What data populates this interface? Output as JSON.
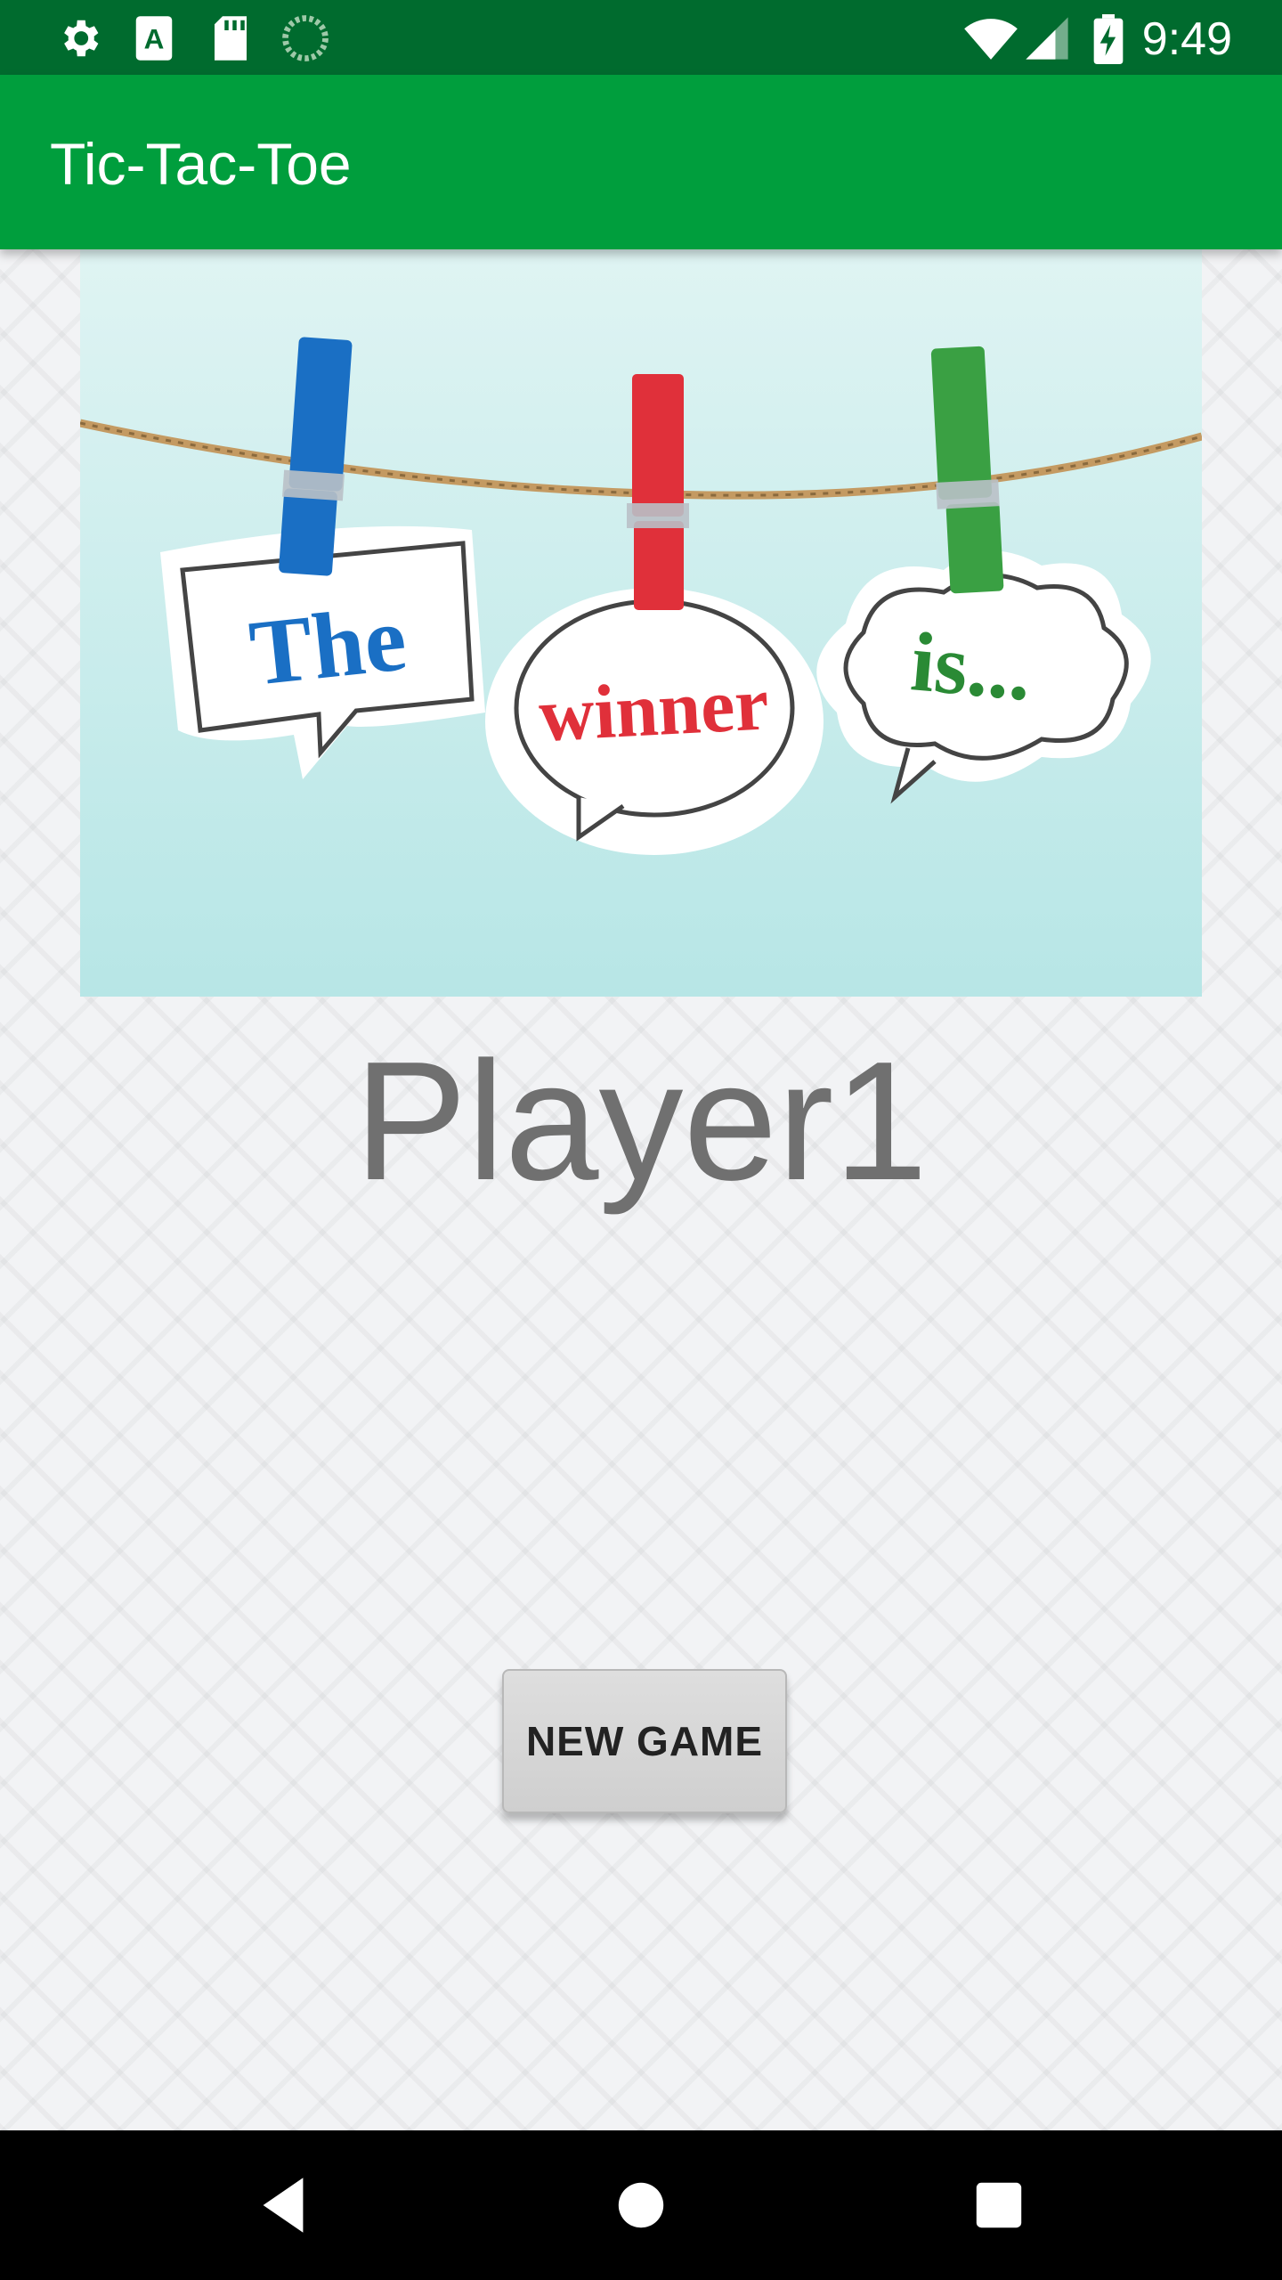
{
  "status_bar": {
    "time": "9:49",
    "icons": [
      "settings-icon",
      "text-a-icon",
      "sd-card-icon",
      "sync-progress-icon",
      "wifi-icon",
      "cell-signal-icon",
      "battery-charging-icon"
    ]
  },
  "app_bar": {
    "title": "Tic-Tac-Toe"
  },
  "hero_image": {
    "words": [
      "The",
      "winner",
      "is..."
    ],
    "background_color": "#bfeaea",
    "peg_colors": [
      "#1a6fc4",
      "#e0303a",
      "#3aa043"
    ]
  },
  "result": {
    "winner": "Player1"
  },
  "actions": {
    "new_game_label": "NEW GAME"
  },
  "nav_bar": {
    "buttons": [
      "back-icon",
      "home-icon",
      "recents-icon"
    ]
  },
  "colors": {
    "status_bar": "#006b2e",
    "app_bar": "#009e3d",
    "winner_text": "#707070"
  }
}
